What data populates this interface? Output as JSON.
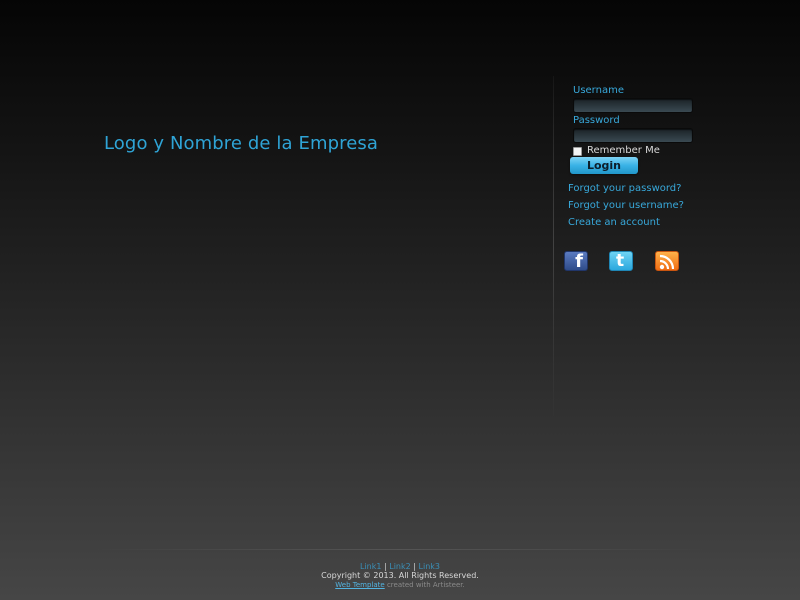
{
  "header": {
    "logo_text": "Logo y Nombre de la Empresa"
  },
  "login": {
    "username_label": "Username",
    "username_value": "",
    "password_label": "Password",
    "password_value": "",
    "remember_label": "Remember Me",
    "remember_checked": false,
    "login_button": "Login",
    "links": [
      "Forgot your password?",
      "Forgot your username?",
      "Create an account"
    ]
  },
  "social": {
    "facebook_icon": "facebook-icon",
    "twitter_icon": "twitter-icon",
    "rss_icon": "rss-icon",
    "facebook_color": "#3b5998",
    "twitter_color": "#33bdeb",
    "rss_color": "#f7801f"
  },
  "footer": {
    "links": [
      "Link1",
      "Link2",
      "Link3"
    ],
    "separator": "|",
    "copyright": "Copyright © 2013. All Rights Reserved.",
    "credit_link": "Web Template",
    "credit_text": "created with Artisteer."
  },
  "colors": {
    "accent": "#2fa4d6",
    "button": "#39b2e6"
  }
}
